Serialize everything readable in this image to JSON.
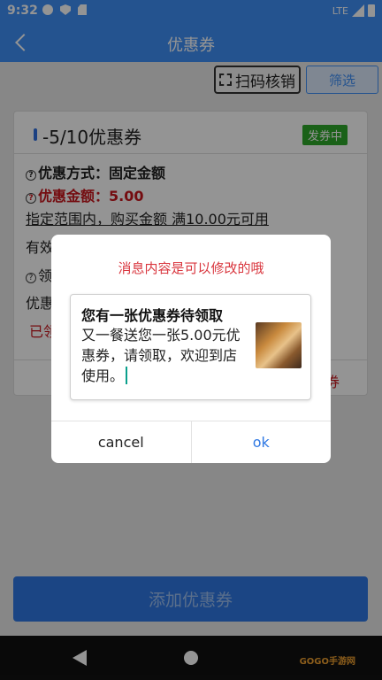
{
  "status_bar": {
    "time": "9:32",
    "network": "LTE"
  },
  "app_bar": {
    "title": "优惠券"
  },
  "toolbar": {
    "scan_label": "扫码核销",
    "filter_label": "筛选"
  },
  "coupon_card": {
    "title": "-5/10优惠券",
    "status_badge": "发券中",
    "method_label": "优惠方式：",
    "method_value": "固定金额",
    "amount_label": "优惠金额：",
    "amount_value": "5.00",
    "condition_text": "指定范围内，购买金额 满10.00元可用",
    "validity_partial": "有效",
    "receive_partial": "领",
    "offer_partial": "优惠",
    "received_partial": "已领",
    "action_partial": "券"
  },
  "add_button": {
    "label": "添加优惠券"
  },
  "dialog": {
    "title": "消息内容是可以修改的哦",
    "message_title": "您有一张优惠券待领取",
    "message_body": "又一餐送您一张5.00元优惠券，请领取，欢迎到店使用。",
    "cancel_label": "cancel",
    "ok_label": "ok"
  },
  "watermark": {
    "text": "GOGO手游网"
  }
}
